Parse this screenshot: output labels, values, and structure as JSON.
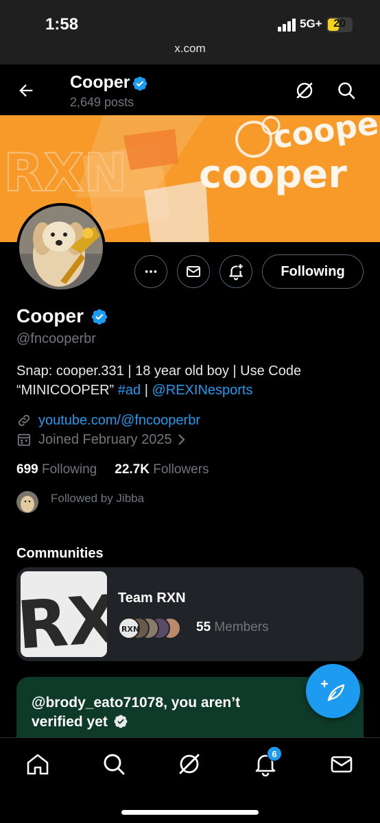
{
  "status_bar": {
    "time": "1:58",
    "network": "5G+",
    "battery": "20",
    "url": "x.com"
  },
  "header": {
    "name": "Cooper",
    "posts": "2,649 posts"
  },
  "profile": {
    "name": "Cooper",
    "handle": "@fncooperbr",
    "bio_text_1": "Snap: cooper.331 | 18 year old boy | Use Code “MINICOOPER” ",
    "bio_hashtag": "#ad",
    "bio_sep": " | ",
    "bio_mention": "@REXINesports",
    "link": "youtube.com/@fncooperbr",
    "joined": "Joined February 2025",
    "following_count": "699",
    "following_label": "Following",
    "followers_count": "22.7K",
    "followers_label": "Followers",
    "followed_by": "Followed by Jibba"
  },
  "banner": {
    "text": "cooper",
    "watermark": "RXN"
  },
  "actions": {
    "following_label": "Following"
  },
  "communities": {
    "title": "Communities",
    "items": [
      {
        "name": "Team RXN",
        "image_text": "RXN",
        "member_count": "55",
        "member_label": "Members"
      }
    ]
  },
  "verify_card": {
    "text": "@brody_eato71078, you aren’t verified yet"
  },
  "bottom_nav": {
    "items": [
      "home-icon",
      "search-icon",
      "grok-icon",
      "notifications-icon",
      "messages-icon"
    ],
    "notifications_badge": "6"
  },
  "colors": {
    "accent": "#1d9bf0",
    "background": "#000000",
    "banner_orange": "#f79a2a",
    "verify_green": "#0e3a2a"
  }
}
